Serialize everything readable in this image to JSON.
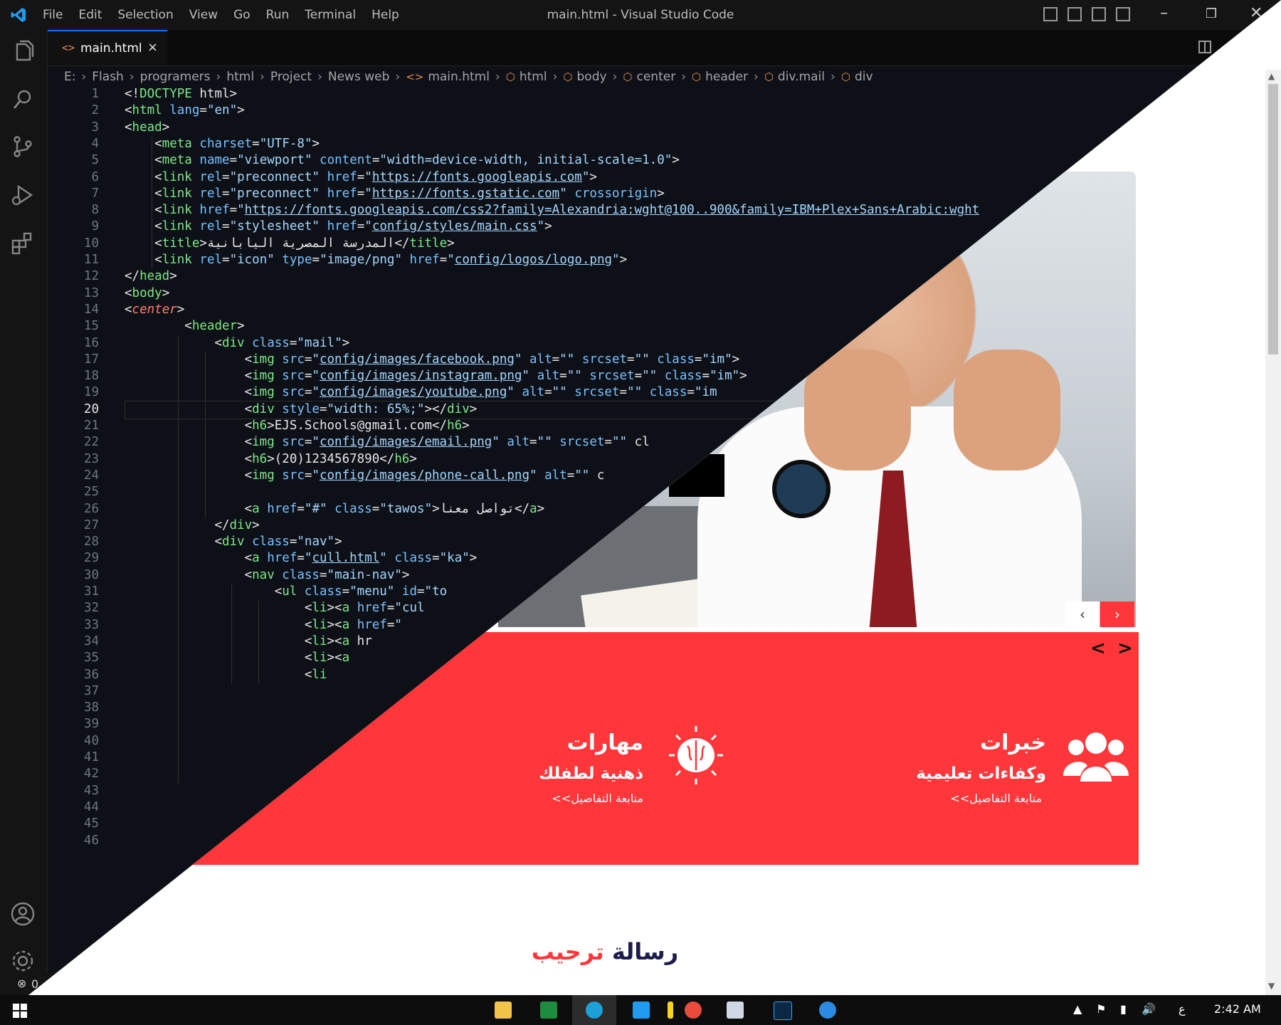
{
  "vscode": {
    "window_title": "main.html - Visual Studio Code",
    "menu": [
      "File",
      "Edit",
      "Selection",
      "View",
      "Go",
      "Run",
      "Terminal",
      "Help"
    ],
    "tab": {
      "label": "main.html",
      "close": "×",
      "icon": "html-file-icon"
    },
    "breadcrumbs": [
      "E:",
      "Flash",
      "programers",
      "html",
      "Project",
      "News web",
      "main.html",
      "html",
      "body",
      "center",
      "header",
      "div.mail",
      "div"
    ],
    "current_line": 20,
    "line_numbers": [
      "1",
      "2",
      "3",
      "4",
      "5",
      "6",
      "7",
      "8",
      "9",
      "10",
      "11",
      "12",
      "13",
      "14",
      "15",
      "16",
      "17",
      "18",
      "19",
      "20",
      "21",
      "22",
      "23",
      "24",
      "25",
      "26",
      "27",
      "28",
      "29",
      "30",
      "31",
      "32",
      "33",
      "34",
      "35",
      "36",
      "37",
      "38",
      "39",
      "40",
      "41",
      "42",
      "43",
      "44",
      "45",
      "46"
    ],
    "code_lines": [
      "<!DOCTYPE html>",
      "<html lang=\"en\">",
      "<head>",
      "    <meta charset=\"UTF-8\">",
      "    <meta name=\"viewport\" content=\"width=device-width, initial-scale=1.0\">",
      "    <link rel=\"preconnect\" href=\"https://fonts.googleapis.com\">",
      "    <link rel=\"preconnect\" href=\"https://fonts.gstatic.com\" crossorigin>",
      "    <link href=\"https://fonts.googleapis.com/css2?family=Alexandria:wght@100..900&family=IBM+Plex+Sans+Arabic:wght",
      "    <link rel=\"stylesheet\" href=\"config/styles/main.css\">",
      "    <title>المدرسة المصرية اليابانية</title>",
      "    <link rel=\"icon\" type=\"image/png\" href=\"config/logos/logo.png\">",
      "</head>",
      "<body>",
      "<center>",
      "        <header>",
      "            <div class=\"mail\">",
      "                <img src=\"config/images/facebook.png\" alt=\"\" srcset=\"\" class=\"im\">",
      "                <img src=\"config/images/instagram.png\" alt=\"\" srcset=\"\" class=\"im\">",
      "                <img src=\"config/images/youtube.png\" alt=\"\" srcset=\"\" class=\"im",
      "                <div style=\"width: 65%;\"></div>",
      "                <h6>EJS.Schools@gmail.com</h6>",
      "                <img src=\"config/images/email.png\" alt=\"\" srcset=\"\" cl",
      "                <h6>(20)1234567890</h6>",
      "                <img src=\"config/images/phone-call.png\" alt=\"\" c",
      "",
      "                <a href=\"#\" class=\"tawos\">تواصل معنا</a>",
      "            </div>",
      "            <div class=\"nav\">",
      "                <a href=\"cull.html\" class=\"ka\">",
      "                <nav class=\"main-nav\">",
      "                    <ul class=\"menu\" id=\"to",
      "                        <li><a href=\"cul",
      "                        <li><a href=\"",
      "                        <li><a hr",
      "                        <li><a",
      "                        <li",
      "",
      "",
      "",
      "",
      "",
      "",
      "",
      "",
      "",
      ""
    ],
    "status": {
      "errors": "0"
    }
  },
  "preview": {
    "hero_prev": "‹",
    "hero_next": "›",
    "features_prev": "<",
    "features_next": ">",
    "feature_1": {
      "title": "خبرات",
      "subtitle": "وكفاءات تعليمية",
      "link": "متابعة التفاصيل>>",
      "icon": "users-icon"
    },
    "feature_2": {
      "title": "مهارات",
      "subtitle": "ذهنية لطفلك",
      "link": "متابعة التفاصيل>>",
      "icon": "brain-icon"
    },
    "welcome": {
      "part1": "رسالة",
      "part2": "ترحيب"
    }
  },
  "taskbar": {
    "apps": [
      "file-explorer-icon",
      "excel-icon",
      "edge-icon",
      "vscode-icon",
      "sticky-notes-icon",
      "screen-recorder-icon",
      "notepad-icon",
      "photoshop-icon",
      "internet-explorer-icon"
    ],
    "language": "ع",
    "time": "2:42 AM"
  },
  "colors": {
    "accent_red": "#ff363a",
    "navy": "#1d1d4b",
    "vscode_blue": "#0d6efd"
  }
}
